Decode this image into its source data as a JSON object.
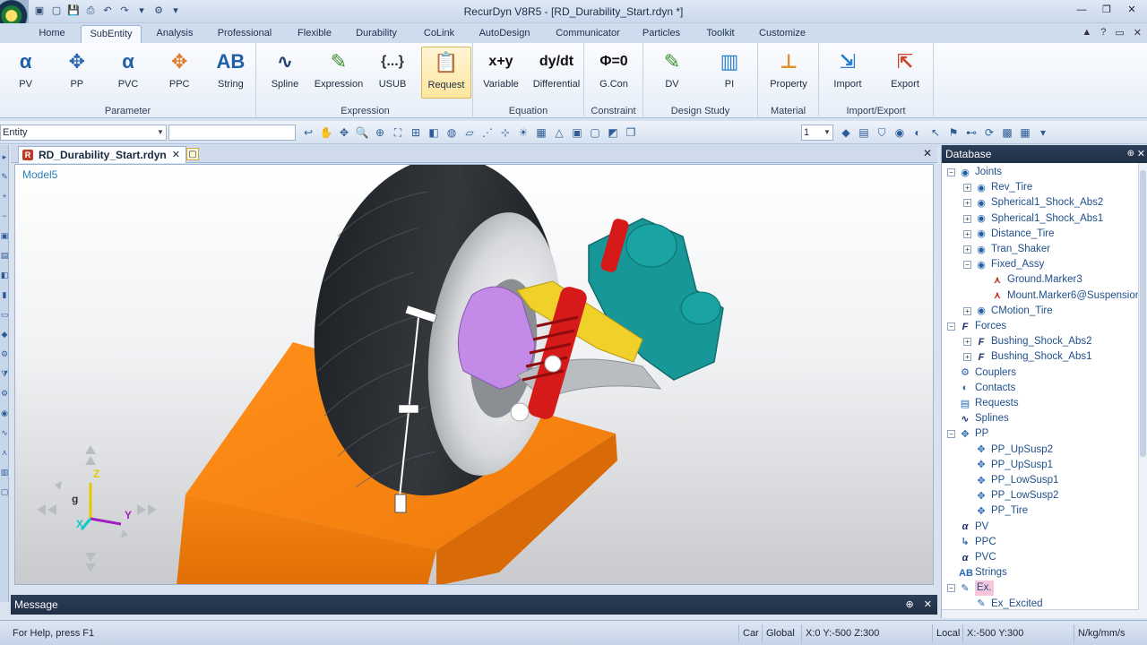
{
  "window": {
    "title": "RecurDyn V8R5 - [RD_Durability_Start.rdyn *]",
    "minimize": "—",
    "restore": "❐",
    "close": "✕"
  },
  "qat": [
    "▣",
    "▢",
    "💾",
    "⎙",
    "↶",
    "↷",
    "▾",
    "⚙",
    "▾"
  ],
  "tabs": [
    "Home",
    "SubEntity",
    "Analysis",
    "Professional",
    "Flexible",
    "Durability",
    "CoLink",
    "AutoDesign",
    "Communicator",
    "Particles",
    "Toolkit",
    "Customize"
  ],
  "active_tab": "SubEntity",
  "tab_right": [
    "▲",
    "?",
    "▭",
    "✕"
  ],
  "ribbon": {
    "groups": [
      {
        "label": "Parameter",
        "buttons": [
          {
            "label": "PV",
            "icon": "α",
            "color": "#1f5fa8"
          },
          {
            "label": "PP",
            "icon": "✥",
            "color": "#2867b2"
          },
          {
            "label": "PVC",
            "icon": "α",
            "color": "#1f5fa8"
          },
          {
            "label": "PPC",
            "icon": "✥",
            "color": "#e07a2a"
          },
          {
            "label": "String",
            "icon": "AB",
            "color": "#1f5fa8"
          }
        ]
      },
      {
        "label": "Expression",
        "buttons": [
          {
            "label": "Spline",
            "icon": "∿",
            "color": "#1f3f6f"
          },
          {
            "label": "Expression",
            "icon": "✎",
            "color": "#3a8f2a"
          },
          {
            "label": "USUB",
            "icon": "{...}",
            "color": "#333333"
          },
          {
            "label": "Request",
            "icon": "📋",
            "color": "#333333"
          }
        ]
      },
      {
        "label": "Equation",
        "buttons": [
          {
            "label": "Variable",
            "icon": "x+y",
            "color": "#111111"
          },
          {
            "label": "Differential",
            "icon": "dy/dt",
            "color": "#111111"
          }
        ]
      },
      {
        "label": "Constraint",
        "buttons": [
          {
            "label": "G.Con",
            "icon": "Φ=0",
            "color": "#111111"
          }
        ]
      },
      {
        "label": "Design Study",
        "buttons": [
          {
            "label": "DV",
            "icon": "✎",
            "color": "#3a8f2a"
          },
          {
            "label": "PI",
            "icon": "▥",
            "color": "#2a7fd0"
          }
        ]
      },
      {
        "label": "Material",
        "buttons": [
          {
            "label": "Property",
            "icon": "⊥",
            "color": "#e0902a"
          }
        ]
      },
      {
        "label": "Import/Export",
        "buttons": [
          {
            "label": "Import",
            "icon": "⇲",
            "color": "#2a7fd0"
          },
          {
            "label": "Export",
            "icon": "⇱",
            "color": "#d0442a"
          }
        ]
      }
    ]
  },
  "toolbar": {
    "entity_combo": "Entity",
    "blank_combo": "",
    "number_combo": "1"
  },
  "document": {
    "tab_label": "RD_Durability_Start.rdyn",
    "tab_close": "✕",
    "viewport_close": "✕",
    "model_label": "Model5",
    "axis_z": "Z",
    "axis_y": "Y",
    "axis_x": "X",
    "axis_g": "g"
  },
  "message": {
    "title": "Message",
    "pin": "⊕",
    "close": "✕"
  },
  "status": {
    "help": "For Help, press F1",
    "mode": "Car",
    "global_label": "Global",
    "global_coords": "X:0 Y:-500 Z:300",
    "local_label": "Local",
    "local_coords": "X:-500 Y:300",
    "units": "N/kg/mm/s"
  },
  "database": {
    "title": "Database",
    "pin": "⊕",
    "close": "✕",
    "items": [
      {
        "label": "Joints",
        "level": 0,
        "exp": "-",
        "icon": "◉",
        "kind": "joint"
      },
      {
        "label": "Rev_Tire",
        "level": 1,
        "exp": "+",
        "icon": "◉",
        "kind": "joint"
      },
      {
        "label": "Spherical1_Shock_Abs2",
        "level": 1,
        "exp": "+",
        "icon": "◉",
        "kind": "joint"
      },
      {
        "label": "Spherical1_Shock_Abs1",
        "level": 1,
        "exp": "+",
        "icon": "◉",
        "kind": "joint"
      },
      {
        "label": "Distance_Tire",
        "level": 1,
        "exp": "+",
        "icon": "◉",
        "kind": "joint"
      },
      {
        "label": "Tran_Shaker",
        "level": 1,
        "exp": "+",
        "icon": "◉",
        "kind": "joint"
      },
      {
        "label": "Fixed_Assy",
        "level": 1,
        "exp": "-",
        "icon": "◉",
        "kind": "joint"
      },
      {
        "label": "Ground.Marker3",
        "level": 2,
        "exp": "",
        "icon": "⋏",
        "kind": "marker"
      },
      {
        "label": "Mount.Marker6@Suspension_",
        "level": 2,
        "exp": "",
        "icon": "⋏",
        "kind": "marker"
      },
      {
        "label": "CMotion_Tire",
        "level": 1,
        "exp": "+",
        "icon": "◉",
        "kind": "joint"
      },
      {
        "label": "Forces",
        "level": 0,
        "exp": "-",
        "icon": "F",
        "kind": "force"
      },
      {
        "label": "Bushing_Shock_Abs2",
        "level": 1,
        "exp": "+",
        "icon": "F",
        "kind": "force"
      },
      {
        "label": "Bushing_Shock_Abs1",
        "level": 1,
        "exp": "+",
        "icon": "F",
        "kind": "force"
      },
      {
        "label": "Couplers",
        "level": 0,
        "exp": "",
        "icon": "⚙",
        "kind": "joint"
      },
      {
        "label": "Contacts",
        "level": 0,
        "exp": "",
        "icon": "◐",
        "kind": "joint"
      },
      {
        "label": "Requests",
        "level": 0,
        "exp": "",
        "icon": "▤",
        "kind": "pp"
      },
      {
        "label": "Splines",
        "level": 0,
        "exp": "",
        "icon": "∿",
        "kind": "force"
      },
      {
        "label": "PP",
        "level": 0,
        "exp": "-",
        "icon": "✥",
        "kind": "pp"
      },
      {
        "label": "PP_UpSusp2",
        "level": 1,
        "exp": "",
        "icon": "✥",
        "kind": "pp"
      },
      {
        "label": "PP_UpSusp1",
        "level": 1,
        "exp": "",
        "icon": "✥",
        "kind": "pp"
      },
      {
        "label": "PP_LowSusp1",
        "level": 1,
        "exp": "",
        "icon": "✥",
        "kind": "pp"
      },
      {
        "label": "PP_LowSusp2",
        "level": 1,
        "exp": "",
        "icon": "✥",
        "kind": "pp"
      },
      {
        "label": "PP_Tire",
        "level": 1,
        "exp": "",
        "icon": "✥",
        "kind": "pp"
      },
      {
        "label": "PV",
        "level": 0,
        "exp": "",
        "icon": "α",
        "kind": "force"
      },
      {
        "label": "PPC",
        "level": 0,
        "exp": "",
        "icon": "↳",
        "kind": "pp"
      },
      {
        "label": "PVC",
        "level": 0,
        "exp": "",
        "icon": "α",
        "kind": "force"
      },
      {
        "label": "Strings",
        "level": 0,
        "exp": "",
        "icon": "AB",
        "kind": "pp"
      },
      {
        "label": "Ex.",
        "level": 0,
        "exp": "-",
        "icon": "✎",
        "kind": "joint",
        "selected": true
      },
      {
        "label": "Ex_Excited",
        "level": 1,
        "exp": "",
        "icon": "✎",
        "kind": "joint"
      }
    ]
  }
}
